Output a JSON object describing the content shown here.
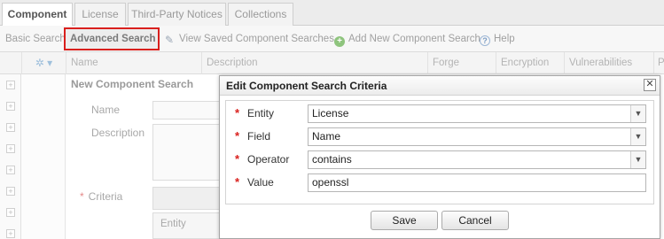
{
  "tabs": [
    "Component",
    "License",
    "Third-Party Notices",
    "Collections"
  ],
  "toolbar": {
    "basic_search": "Basic Search",
    "advanced_search": "Advanced Search",
    "view_saved": "View Saved Component Searches",
    "add_new": "Add New Component Search",
    "help": "Help"
  },
  "grid": {
    "columns": [
      "Name",
      "Description",
      "Forge",
      "Encryption",
      "Vulnerabilities",
      "P"
    ]
  },
  "new_search": {
    "title": "New Component Search",
    "name_label": "Name",
    "description_label": "Description",
    "criteria_label": "Criteria",
    "entity_col": "Entity"
  },
  "dialog": {
    "title": "Edit Component Search Criteria",
    "close": "✕",
    "fields": {
      "entity": {
        "label": "Entity",
        "value": "License"
      },
      "field": {
        "label": "Field",
        "value": "Name"
      },
      "operator": {
        "label": "Operator",
        "value": "contains"
      },
      "value": {
        "label": "Value",
        "value": "openssl"
      }
    },
    "save": "Save",
    "cancel": "Cancel"
  },
  "colors": {
    "highlight": "#d9201d",
    "required": "#d9201d"
  }
}
